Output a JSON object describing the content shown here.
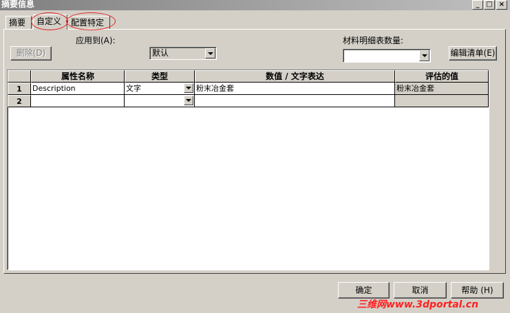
{
  "window": {
    "title": "摘要信息"
  },
  "tabs": [
    {
      "label": "摘要"
    },
    {
      "label": "自定义"
    },
    {
      "label": "配置特定"
    }
  ],
  "form": {
    "delete_label": "删除(D)",
    "apply_to_label": "应用到(A):",
    "apply_to_value": "默认",
    "bom_qty_label": "材料明细表数量:",
    "bom_qty_value": "",
    "edit_list_label": "编辑清单(E)"
  },
  "grid": {
    "headers": [
      "属性名称",
      "类型",
      "数值 / 文字表达",
      "评估的值"
    ],
    "rows": [
      {
        "num": "1",
        "name": "Description",
        "type": "文字",
        "value": "粉末冶金套",
        "evaluated": "粉末冶金套"
      },
      {
        "num": "2",
        "name": "",
        "type": "",
        "value": "",
        "evaluated": ""
      }
    ]
  },
  "buttons": {
    "ok": "确定",
    "cancel": "取消",
    "help": "帮助 (H)"
  },
  "watermark": {
    "cn": "三维网",
    "url": "www.3dportal.cn"
  },
  "colors": {
    "face": "#d4d0c8",
    "annotation": "#e02020",
    "watermark_red": "#ff2020"
  }
}
